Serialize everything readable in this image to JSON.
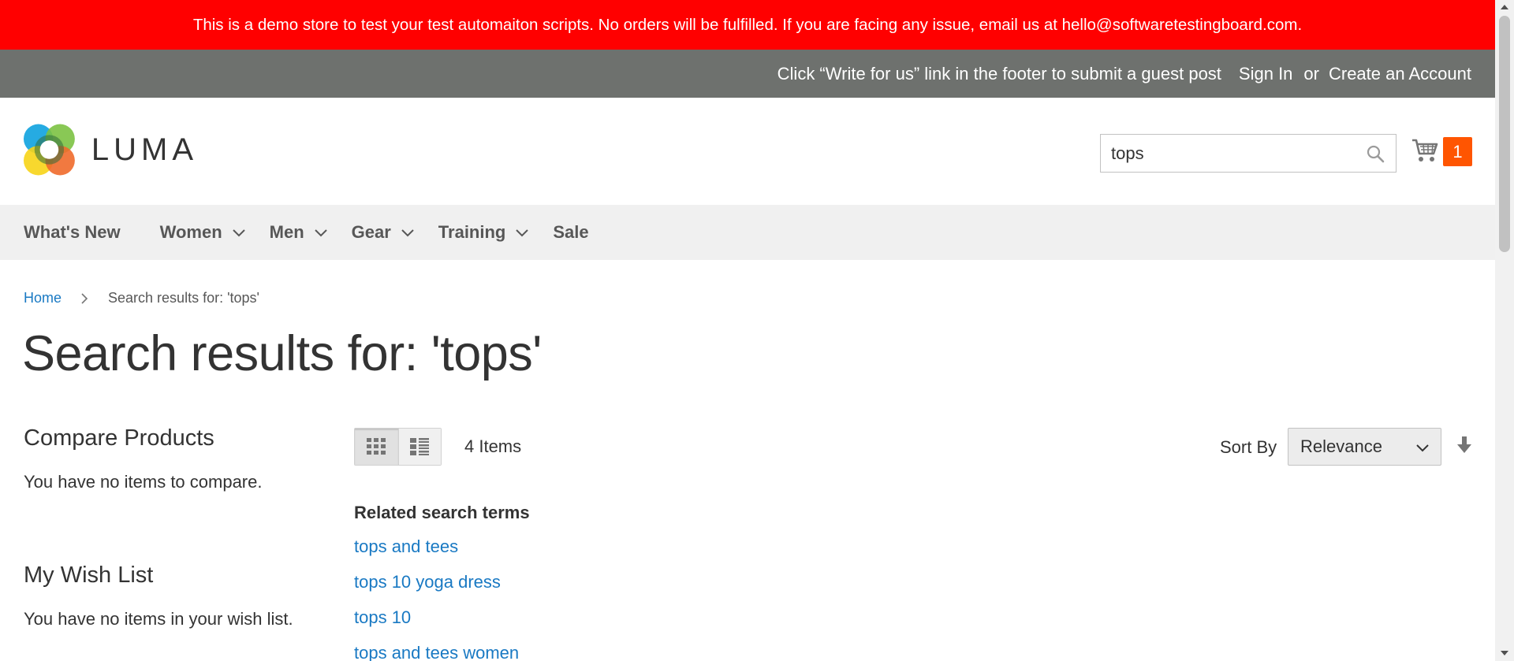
{
  "demo_banner": {
    "text": "This is a demo store to test your test automaiton scripts. No orders will be fulfilled. If you are facing any issue, email us at hello@softwaretestingboard.com."
  },
  "top_bar": {
    "notice": "Click “Write for us” link in the footer to submit a guest post",
    "sign_in": "Sign In",
    "or": "or",
    "create_account": "Create an Account"
  },
  "header": {
    "logo_text": "LUMA",
    "search": {
      "value": "tops",
      "icon": "search-icon"
    },
    "cart": {
      "icon": "cart-icon",
      "count": "1",
      "badge_color": "#ff5501"
    }
  },
  "nav": {
    "items": [
      {
        "label": "What's New",
        "has_submenu": false
      },
      {
        "label": "Women",
        "has_submenu": true
      },
      {
        "label": "Men",
        "has_submenu": true
      },
      {
        "label": "Gear",
        "has_submenu": true
      },
      {
        "label": "Training",
        "has_submenu": true
      },
      {
        "label": "Sale",
        "has_submenu": false
      }
    ]
  },
  "breadcrumb": {
    "home": "Home",
    "current": "Search results for: 'tops'"
  },
  "page_title": "Search results for: 'tops'",
  "sidebar": {
    "compare": {
      "title": "Compare Products",
      "empty": "You have no items to compare."
    },
    "wishlist": {
      "title": "My Wish List",
      "empty": "You have no items in your wish list."
    }
  },
  "toolbar": {
    "modes": [
      {
        "name": "grid",
        "active": true
      },
      {
        "name": "list",
        "active": false
      }
    ],
    "items_count": "4 Items",
    "sort_label": "Sort By",
    "sort_value": "Relevance",
    "sort_direction_icon": "arrow-down-icon"
  },
  "related": {
    "title": "Related search terms",
    "terms": [
      "tops and tees",
      "tops 10 yoga dress",
      "tops 10",
      "tops and tees women"
    ]
  },
  "colors": {
    "banner": "#ff0000",
    "top_bar": "#6e716e",
    "link": "#1979c3",
    "nav_bg": "#f0f0f0"
  }
}
